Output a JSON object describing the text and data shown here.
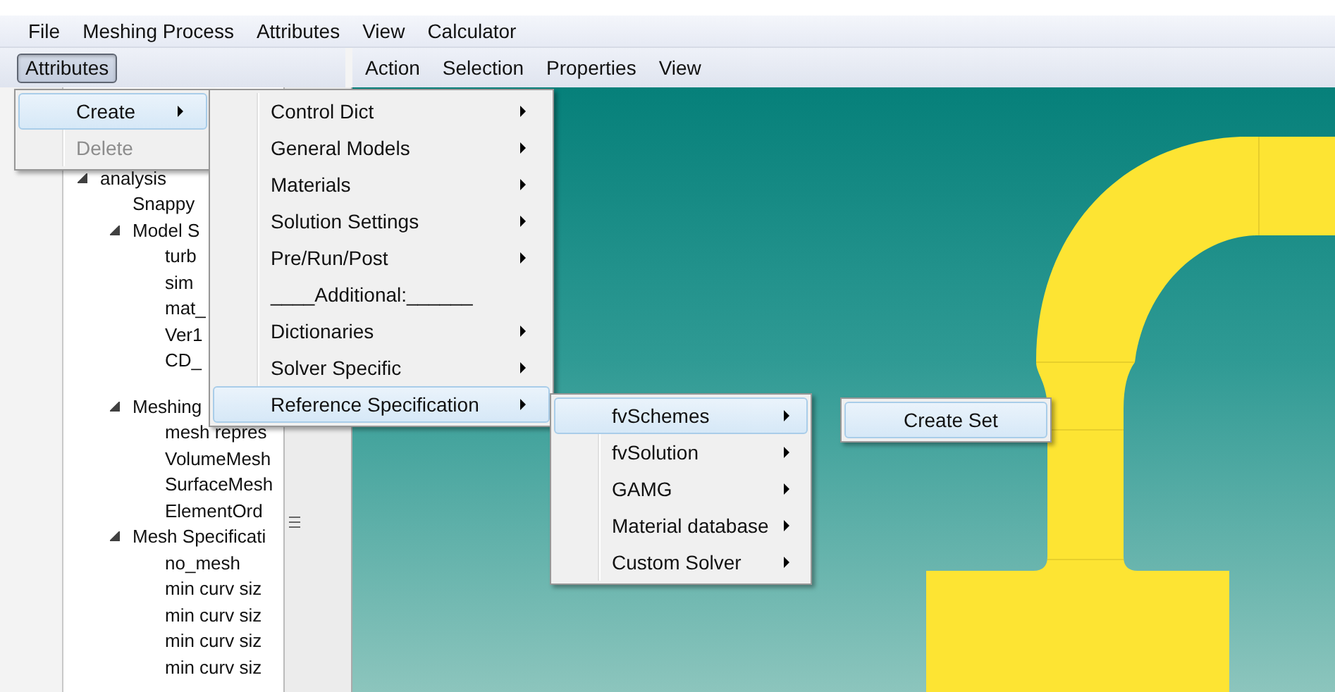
{
  "menu_bar": [
    "File",
    "Meshing Process",
    "Attributes",
    "View",
    "Calculator"
  ],
  "attributes_button": {
    "label": "Attributes",
    "pressed": true
  },
  "toolbar": [
    "Action",
    "Selection",
    "Properties",
    "View"
  ],
  "tree": [
    {
      "label": "analysis",
      "expanded": true,
      "children": [
        {
          "label": "Snappy"
        },
        {
          "label": "Model S",
          "expanded": true,
          "children": [
            {
              "label": "turb"
            },
            {
              "label": "sim"
            },
            {
              "label": "mat_"
            },
            {
              "label": "Ver1"
            },
            {
              "label": "CD_"
            }
          ]
        },
        {
          "label": "Meshing",
          "expanded": true,
          "children": [
            {
              "label": "mesh repres"
            },
            {
              "label": "VolumeMesh"
            },
            {
              "label": "SurfaceMesh"
            },
            {
              "label": "ElementOrd"
            }
          ]
        },
        {
          "label": "Mesh Specificati",
          "expanded": true,
          "children": [
            {
              "label": "no_mesh"
            },
            {
              "label": "min curv siz"
            },
            {
              "label": "min curv siz"
            },
            {
              "label": "min curv siz"
            },
            {
              "label": "min curv siz"
            }
          ]
        }
      ]
    }
  ],
  "menus": [
    {
      "items": [
        {
          "label": "Create",
          "kind": "submenu",
          "selected": true,
          "disabled": false
        },
        {
          "label": "Delete",
          "kind": "command",
          "selected": false,
          "disabled": true
        }
      ]
    },
    {
      "items": [
        {
          "label": "Control Dict",
          "kind": "submenu",
          "selected": false
        },
        {
          "label": "General Models",
          "kind": "submenu",
          "selected": false
        },
        {
          "label": "Materials",
          "kind": "submenu",
          "selected": false
        },
        {
          "label": "Solution Settings",
          "kind": "submenu",
          "selected": false
        },
        {
          "label": "Pre/Run/Post",
          "kind": "submenu",
          "selected": false
        },
        {
          "label": "____Additional:______",
          "kind": "command",
          "selected": false
        },
        {
          "label": "Dictionaries",
          "kind": "submenu",
          "selected": false
        },
        {
          "label": "Solver Specific",
          "kind": "submenu",
          "selected": false
        },
        {
          "label": "Reference Specification",
          "kind": "submenu",
          "selected": true
        }
      ]
    },
    {
      "items": [
        {
          "label": "fvSchemes",
          "kind": "submenu",
          "selected": true
        },
        {
          "label": "fvSolution",
          "kind": "submenu",
          "selected": false
        },
        {
          "label": "GAMG",
          "kind": "submenu",
          "selected": false
        },
        {
          "label": "Material database",
          "kind": "submenu",
          "selected": false
        },
        {
          "label": "Custom Solver",
          "kind": "submenu",
          "selected": false
        }
      ]
    },
    {
      "items": [
        {
          "label": "Create Set",
          "kind": "command",
          "selected": true
        }
      ]
    }
  ]
}
